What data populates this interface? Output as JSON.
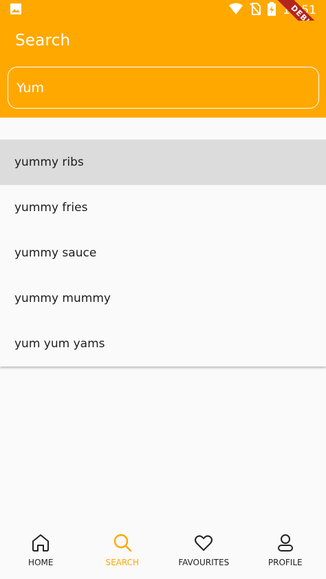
{
  "status_bar": {
    "time": "12:51",
    "icons": [
      "image-icon",
      "wifi-icon",
      "no-sim-icon",
      "battery-charging-icon"
    ]
  },
  "app_bar": {
    "title": "Search",
    "debug_label": "DEBUG"
  },
  "search": {
    "value": "Yum",
    "placeholder": ""
  },
  "results": [
    {
      "label": "yummy ribs",
      "selected": true
    },
    {
      "label": "yummy fries",
      "selected": false
    },
    {
      "label": "yummy sauce",
      "selected": false
    },
    {
      "label": "yummy mummy",
      "selected": false
    },
    {
      "label": "yum yum yams",
      "selected": false
    }
  ],
  "bottom_nav": {
    "items": [
      {
        "label": "HOME",
        "icon": "home-icon",
        "active": false
      },
      {
        "label": "SEARCH",
        "icon": "search-icon",
        "active": true
      },
      {
        "label": "FAVOURITES",
        "icon": "heart-icon",
        "active": false
      },
      {
        "label": "PROFILE",
        "icon": "profile-icon",
        "active": false
      }
    ]
  },
  "colors": {
    "accent": "#ffa800",
    "selected_row": "#dcdcdc",
    "background": "#fafafa"
  }
}
